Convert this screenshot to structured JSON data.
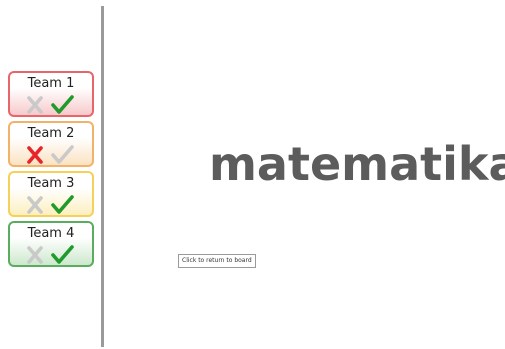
{
  "teams": [
    {
      "name": "Team 1",
      "color": "red",
      "active_mark": "check"
    },
    {
      "name": "Team 2",
      "color": "orange",
      "active_mark": "x"
    },
    {
      "name": "Team 3",
      "color": "yellow",
      "active_mark": "check"
    },
    {
      "name": "Team 4",
      "color": "green",
      "active_mark": "check"
    }
  ],
  "icons": {
    "x": "x-icon",
    "check": "check-icon"
  },
  "colors": {
    "x_active": "#e8232a",
    "check_active": "#1f9a2b",
    "inactive": "#c9c9c9",
    "logo": "#5c5c5c"
  },
  "main": {
    "logo_text": "matematika",
    "return_button_label": "Click to return to board"
  }
}
